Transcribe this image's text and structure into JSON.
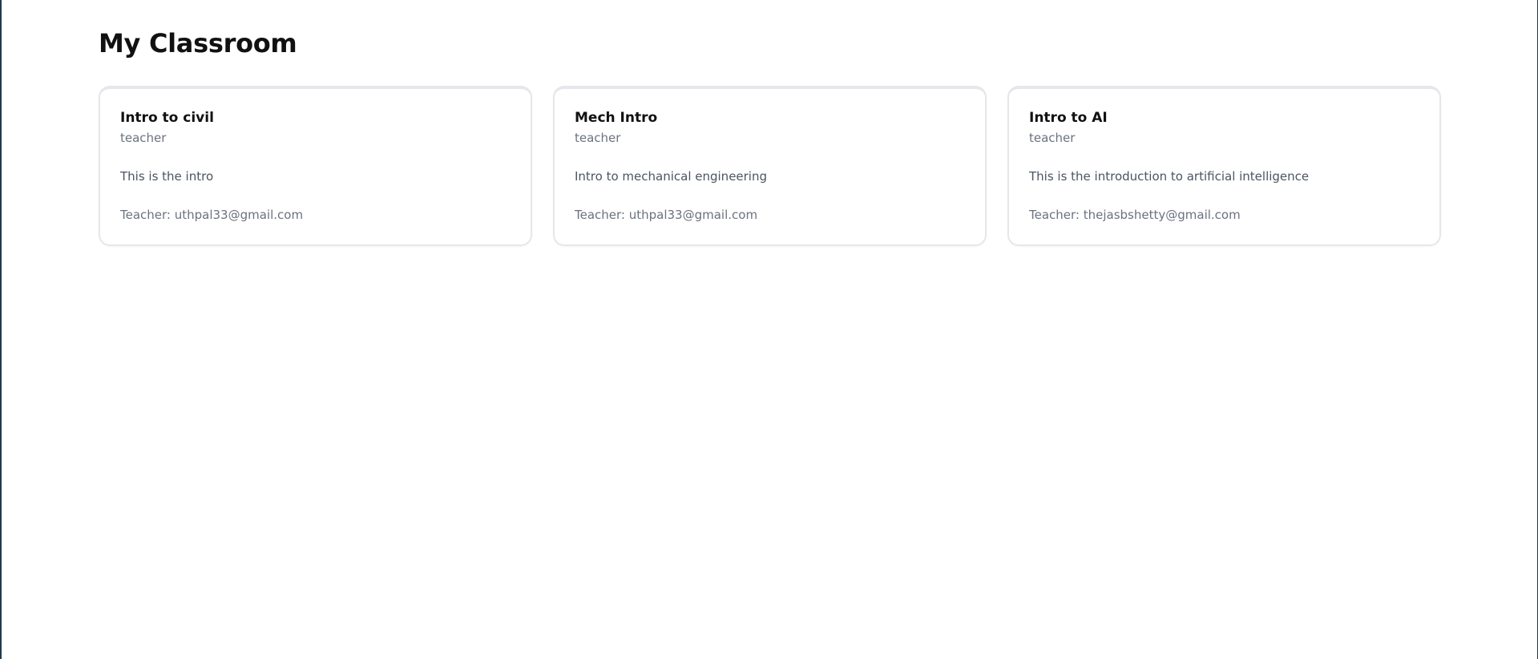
{
  "page": {
    "title": "My Classroom"
  },
  "classes": [
    {
      "name": "Intro to civil",
      "role": "teacher",
      "description": "This is the intro",
      "teacher_label": "Teacher: uthpal33@gmail.com"
    },
    {
      "name": "Mech Intro",
      "role": "teacher",
      "description": "Intro to mechanical engineering",
      "teacher_label": "Teacher: uthpal33@gmail.com"
    },
    {
      "name": "Intro to AI",
      "role": "teacher",
      "description": "This is the introduction to artificial intelligence",
      "teacher_label": "Teacher: thejasbshetty@gmail.com"
    }
  ],
  "colors": {
    "frame_border": "#1f3a4d",
    "card_border": "#e5e7eb",
    "title_text": "#111111",
    "muted_text": "#6b7280"
  }
}
